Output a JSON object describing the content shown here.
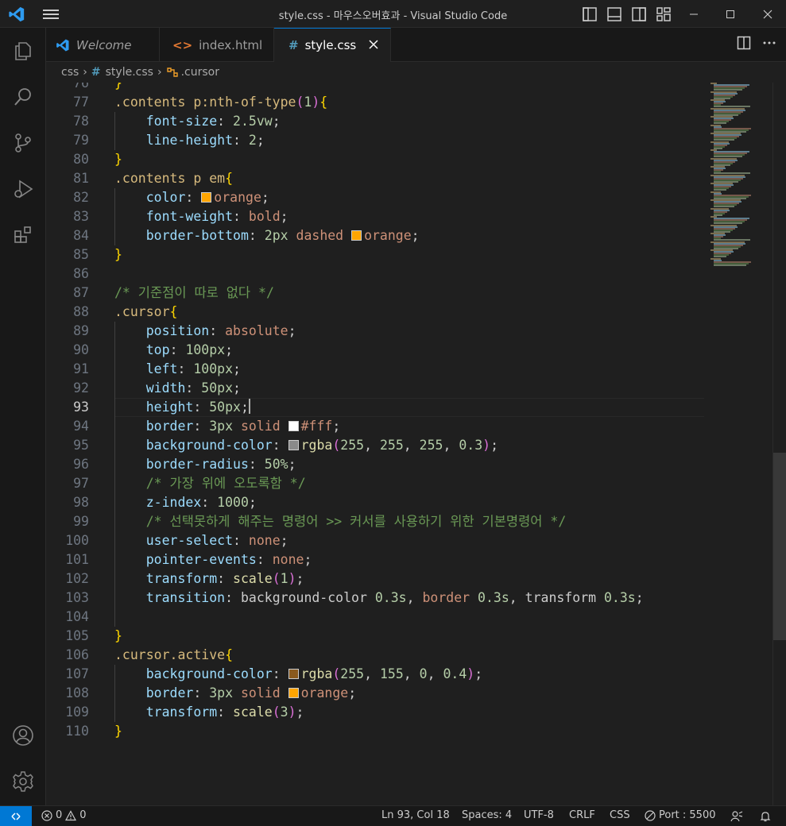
{
  "window": {
    "title": "style.css - 마우스오버효과 - Visual Studio Code"
  },
  "tabs": [
    {
      "icon": "vscode-icon",
      "label": "Welcome"
    },
    {
      "icon": "html-icon",
      "label": "index.html"
    },
    {
      "icon": "hash-icon",
      "label": "style.css",
      "active": true
    }
  ],
  "breadcrumb": {
    "folder": "css",
    "file": "style.css",
    "symbol": ".cursor"
  },
  "colors": {
    "accent": "#0078d4",
    "orange": "#ffa500",
    "white_swatch": "#ffffff",
    "rgba_white": "#8a8a8a",
    "rgba_orange": "#8a5a1e"
  },
  "editor": {
    "current_line": 93,
    "lines": [
      {
        "n": "76",
        "t": "}"
      },
      {
        "n": "77",
        "t": ".contents p:nth-of-type(1){"
      },
      {
        "n": "78",
        "t": "    font-size: 2.5vw;"
      },
      {
        "n": "79",
        "t": "    line-height: 2;"
      },
      {
        "n": "80",
        "t": "}"
      },
      {
        "n": "81",
        "t": ".contents p em{"
      },
      {
        "n": "82",
        "t": "    color: orange;"
      },
      {
        "n": "83",
        "t": "    font-weight: bold;"
      },
      {
        "n": "84",
        "t": "    border-bottom: 2px dashed orange;"
      },
      {
        "n": "85",
        "t": "}"
      },
      {
        "n": "86",
        "t": ""
      },
      {
        "n": "87",
        "t": "/* 기준점이 따로 없다 */"
      },
      {
        "n": "88",
        "t": ".cursor{"
      },
      {
        "n": "89",
        "t": "    position: absolute;"
      },
      {
        "n": "90",
        "t": "    top: 100px;"
      },
      {
        "n": "91",
        "t": "    left: 100px;"
      },
      {
        "n": "92",
        "t": "    width: 50px;"
      },
      {
        "n": "93",
        "t": "    height: 50px;"
      },
      {
        "n": "94",
        "t": "    border: 3px solid #fff;"
      },
      {
        "n": "95",
        "t": "    background-color: rgba(255, 255, 255, 0.3);"
      },
      {
        "n": "96",
        "t": "    border-radius: 50%;"
      },
      {
        "n": "97",
        "t": "    /* 가장 위에 오도록함 */"
      },
      {
        "n": "98",
        "t": "    z-index: 1000;"
      },
      {
        "n": "99",
        "t": "    /* 선택못하게 해주는 명령어 >> 커서를 사용하기 위한 기본명령어 */"
      },
      {
        "n": "100",
        "t": "    user-select: none;"
      },
      {
        "n": "101",
        "t": "    pointer-events: none;"
      },
      {
        "n": "102",
        "t": "    transform: scale(1);"
      },
      {
        "n": "103",
        "t": "    transition: background-color 0.3s, border 0.3s, transform 0.3s;"
      },
      {
        "n": "104",
        "t": ""
      },
      {
        "n": "105",
        "t": "}"
      },
      {
        "n": "106",
        "t": ".cursor.active{"
      },
      {
        "n": "107",
        "t": "    background-color: rgba(255, 155, 0, 0.4);"
      },
      {
        "n": "108",
        "t": "    border: 3px solid orange;"
      },
      {
        "n": "109",
        "t": "    transform: scale(3);"
      },
      {
        "n": "110",
        "t": "}"
      }
    ]
  },
  "statusbar": {
    "errors": "0",
    "warnings": "0",
    "position": "Ln 93, Col 18",
    "spaces": "Spaces: 4",
    "encoding": "UTF-8",
    "eol": "CRLF",
    "language": "CSS",
    "port": "Port : 5500"
  }
}
